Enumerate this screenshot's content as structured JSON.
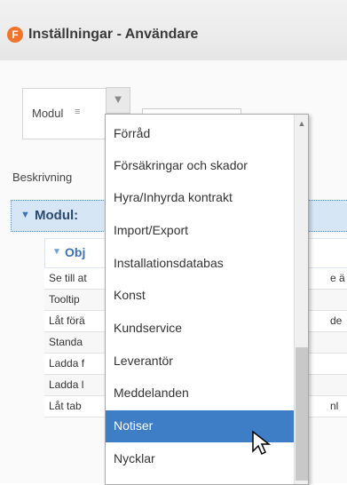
{
  "window": {
    "app_icon_letter": "F",
    "title": "Inställningar - Användare"
  },
  "column_header": {
    "label": "Modul",
    "sort_icon": "sort-icon",
    "filter_icon": "filter-icon"
  },
  "beskrivning_label": "Beskrivning",
  "group": {
    "label": "Modul:"
  },
  "subgroup": {
    "label": "Obj"
  },
  "rows": [
    {
      "text": "Se till at",
      "right": "e ä"
    },
    {
      "text": "Tooltip",
      "right": ""
    },
    {
      "text": "Låt förä",
      "right": "de"
    },
    {
      "text": "Standa",
      "right": ""
    },
    {
      "text": "Ladda f",
      "right": ""
    },
    {
      "text": "Ladda l",
      "right": ""
    },
    {
      "text": "Låt tab",
      "right": "nl"
    }
  ],
  "dropdown": {
    "items": [
      "Förråd",
      "Försäkringar och skador",
      "Hyra/Inhyrda kontrakt",
      "Import/Export",
      "Installationsdatabas",
      "Konst",
      "Kundservice",
      "Leverantör",
      "Meddelanden",
      "Notiser",
      "Nycklar"
    ],
    "selected_index": 9,
    "scroll_up_icon": "chevron-up-icon"
  },
  "colors": {
    "accent": "#3d7ec7",
    "app_icon": "#f0742c",
    "group_bg": "#d6e6f5"
  }
}
